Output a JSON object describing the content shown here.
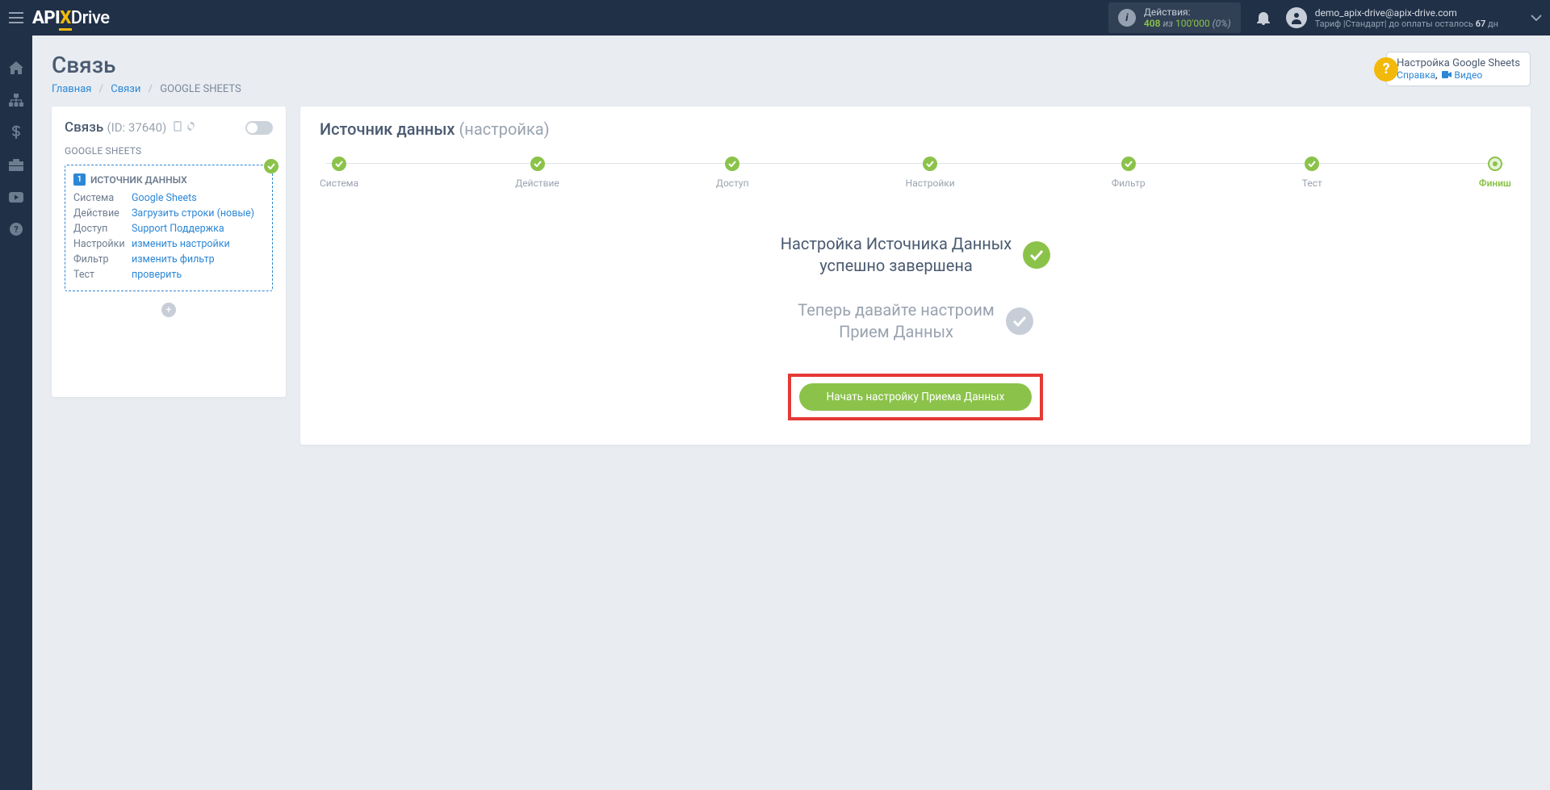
{
  "topbar": {
    "actions_label": "Действия:",
    "actions_count": "408",
    "actions_of": "из",
    "actions_total": "100'000",
    "actions_pct": "(0%)",
    "user_email": "demo_apix-drive@apix-drive.com",
    "plan_prefix": "Тариф |Стандарт| до оплаты осталось ",
    "plan_days": "67",
    "plan_suffix": " дн"
  },
  "page": {
    "title": "Связь",
    "crumb_home": "Главная",
    "crumb_links": "Связи",
    "crumb_current": "GOOGLE SHEETS"
  },
  "helpbox": {
    "title": "Настройка Google Sheets",
    "help_link": "Справка",
    "video_link": "Видео"
  },
  "left": {
    "title": "Связь",
    "id_label": "(ID: 37640)",
    "subtitle": "GOOGLE SHEETS",
    "block_title": "ИСТОЧНИК ДАННЫХ",
    "block_index": "1",
    "rows": {
      "r0k": "Система",
      "r0v": "Google Sheets",
      "r1k": "Действие",
      "r1v": "Загрузить строки (новые)",
      "r2k": "Доступ",
      "r2v": "Support Поддержка",
      "r3k": "Настройки",
      "r3v": "изменить настройки",
      "r4k": "Фильтр",
      "r4v": "изменить фильтр",
      "r5k": "Тест",
      "r5v": "проверить"
    }
  },
  "right": {
    "title": "Источник данных ",
    "subtitle": "(настройка)",
    "steps": {
      "s0": "Система",
      "s1": "Действие",
      "s2": "Доступ",
      "s3": "Настройки",
      "s4": "Фильтр",
      "s5": "Тест",
      "s6": "Финиш"
    },
    "status1_l1": "Настройка Источника Данных",
    "status1_l2": "успешно завершена",
    "status2_l1": "Теперь давайте настроим",
    "status2_l2": "Прием Данных",
    "cta": "Начать настройку Приема Данных"
  }
}
